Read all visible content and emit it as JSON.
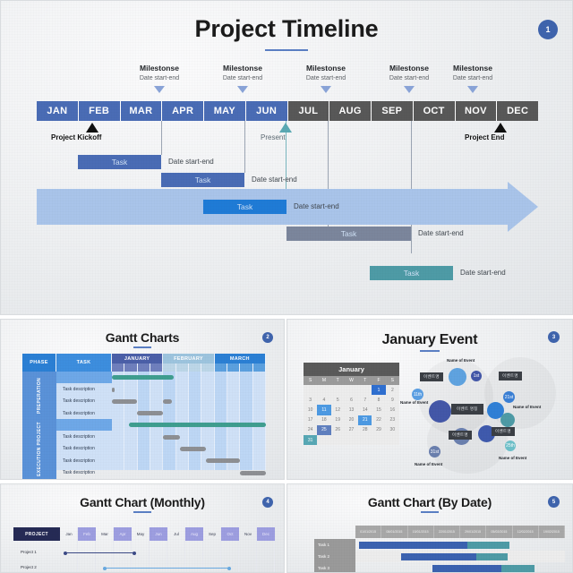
{
  "slides": {
    "main": {
      "title": "Project Timeline",
      "page_number": "1",
      "months": [
        {
          "label": "JAN",
          "tone": "blue"
        },
        {
          "label": "FEB",
          "tone": "blue"
        },
        {
          "label": "MAR",
          "tone": "blue"
        },
        {
          "label": "APR",
          "tone": "blue"
        },
        {
          "label": "MAY",
          "tone": "blue"
        },
        {
          "label": "JUN",
          "tone": "blue"
        },
        {
          "label": "JUL",
          "tone": "gray"
        },
        {
          "label": "AUG",
          "tone": "gray"
        },
        {
          "label": "SEP",
          "tone": "gray"
        },
        {
          "label": "OCT",
          "tone": "gray"
        },
        {
          "label": "NOV",
          "tone": "gray"
        },
        {
          "label": "DEC",
          "tone": "gray"
        }
      ],
      "milestones": [
        {
          "title": "Milestonse",
          "date": "Date start-end"
        },
        {
          "title": "Milestonse",
          "date": "Date start-end"
        },
        {
          "title": "Milestonse",
          "date": "Date start-end"
        },
        {
          "title": "Milestonse",
          "date": "Date start-end"
        },
        {
          "title": "Milestonse",
          "date": "Date start-end"
        }
      ],
      "markers": {
        "kickoff": "Project Kickoff",
        "present": "Present",
        "end": "Project End"
      },
      "tasks": [
        {
          "label": "Task",
          "date": "Date start-end",
          "color": "#4a6cb5"
        },
        {
          "label": "Task",
          "date": "Date start-end",
          "color": "#4a6cb5"
        },
        {
          "label": "Task",
          "date": "Date start-end",
          "color": "#1f7bd6"
        },
        {
          "label": "Task",
          "date": "Date start-end",
          "color": "#7b869c"
        },
        {
          "label": "Task",
          "date": "Date start-end",
          "color": "#4e9ba6"
        }
      ],
      "colors": {
        "month_blue": "#4a6cb5",
        "month_gray": "#585858",
        "arrow": "#a9c4ea",
        "milestone_arrow": "#8aa4d8",
        "accent_teal": "#4fa3ad"
      }
    },
    "gantt_charts": {
      "title": "Gantt Charts",
      "page_number": "2",
      "headers": [
        "PHASE",
        "TASK",
        "JANUARY",
        "FEBRUARY",
        "MARCH"
      ],
      "phases": [
        "PREPERATION",
        "EXECUTION PROJECT"
      ],
      "task_label": "Task description",
      "rows": [
        {
          "phase": "PREPERATION",
          "task": "",
          "bar": {
            "start": 0,
            "len": 40,
            "color": "#3f9e90"
          }
        },
        {
          "phase": "PREPERATION",
          "task": "Task description",
          "bar": {
            "start": 0,
            "len": 2,
            "color": "#8d8f93"
          }
        },
        {
          "phase": "PREPERATION",
          "task": "Task description",
          "bar": {
            "start": 0,
            "len": 16,
            "color": "#8d8f93"
          },
          "bar2": {
            "start": 33,
            "len": 6,
            "color": "#8d8f93"
          }
        },
        {
          "phase": "PREPERATION",
          "task": "Task description",
          "bar": {
            "start": 16,
            "len": 17,
            "color": "#8d8f93"
          }
        },
        {
          "phase": "EXECUTION PROJECT",
          "task": "",
          "bar": {
            "start": 11,
            "len": 89,
            "color": "#3f9e90"
          }
        },
        {
          "phase": "EXECUTION PROJECT",
          "task": "Task description",
          "bar": {
            "start": 33,
            "len": 11,
            "color": "#8d8f93"
          }
        },
        {
          "phase": "EXECUTION PROJECT",
          "task": "Task description",
          "bar": {
            "start": 44,
            "len": 17,
            "color": "#8d8f93"
          }
        },
        {
          "phase": "EXECUTION PROJECT",
          "task": "Task description",
          "bar": {
            "start": 61,
            "len": 22,
            "color": "#8d8f93"
          }
        },
        {
          "phase": "EXECUTION PROJECT",
          "task": "Task description",
          "bar": {
            "start": 83,
            "len": 17,
            "color": "#8d8f93"
          }
        }
      ],
      "colors": {
        "header_blue": "#2b7fd4",
        "header_jan": "#4b5fa8",
        "header_feb": "#9dc4de",
        "header_mar": "#2b7fd4",
        "body": "#cfe1f7",
        "bar_green": "#3f9e90",
        "bar_gray": "#8d8f93"
      }
    },
    "january_event": {
      "title": "January Event",
      "page_number": "3",
      "calendar": {
        "month": "January",
        "dow": [
          "S",
          "M",
          "T",
          "W",
          "T",
          "F",
          "S"
        ],
        "lead_blanks": 5,
        "days": 31,
        "highlights": {
          "1": "hl1",
          "11": "hl2",
          "21": "hl2",
          "25": "hl3",
          "31": "hl4"
        }
      },
      "event_label": "Name of Event",
      "event_tag": "이벤트명",
      "event_tag_center": "이벤트 명칭",
      "bubble_dates": [
        "1st",
        "11th",
        "21st",
        "31st",
        "25th"
      ],
      "colors": {
        "blue": "#3a7fd5",
        "deep": "#3f5aad",
        "teal": "#4e9ba6",
        "slate": "#6a7fae"
      }
    },
    "gantt_monthly": {
      "title": "Gantt Chart (Monthly)",
      "page_number": "4",
      "project_header": "PROJECT",
      "months": [
        "Jan",
        "Feb",
        "Mar",
        "Apr",
        "May",
        "Jun",
        "Jul",
        "Aug",
        "Sep",
        "Oct",
        "Nov",
        "Dec"
      ],
      "rows": [
        {
          "label": "Project 1",
          "start": 8,
          "end": 35,
          "color": "#3c4a86"
        },
        {
          "label": "Project 2",
          "start": 22,
          "end": 70,
          "color": "#68a9e0"
        }
      ],
      "colors": {
        "header": "#252a55",
        "alt_month": "#9d9ee0"
      }
    },
    "gantt_bydate": {
      "title": "Gantt Chart (By Date)",
      "page_number": "5",
      "dates": [
        "01/01/2015",
        "08/01/2015",
        "15/01/2015",
        "22/01/2015",
        "29/01/2015",
        "05/02/2015",
        "12/02/2015",
        "19/02/2015"
      ],
      "rows": [
        {
          "label": "Task 1",
          "start": 2,
          "main": 52,
          "tail": 20,
          "main_color": "#3b62b0",
          "tail_color": "#4e9ba6"
        },
        {
          "label": "Task 2",
          "start": 22,
          "main": 36,
          "tail": 15,
          "main_color": "#3b62b0",
          "tail_color": "#4e9ba6"
        },
        {
          "label": "Task 3",
          "start": 37,
          "main": 33,
          "tail": 16,
          "main_color": "#3b62b0",
          "tail_color": "#4e9ba6"
        }
      ],
      "colors": {
        "header": "#a8a8a8",
        "label": "#9a9a9a",
        "bar_blue": "#3b62b0",
        "bar_teal": "#4e9ba6"
      }
    }
  }
}
